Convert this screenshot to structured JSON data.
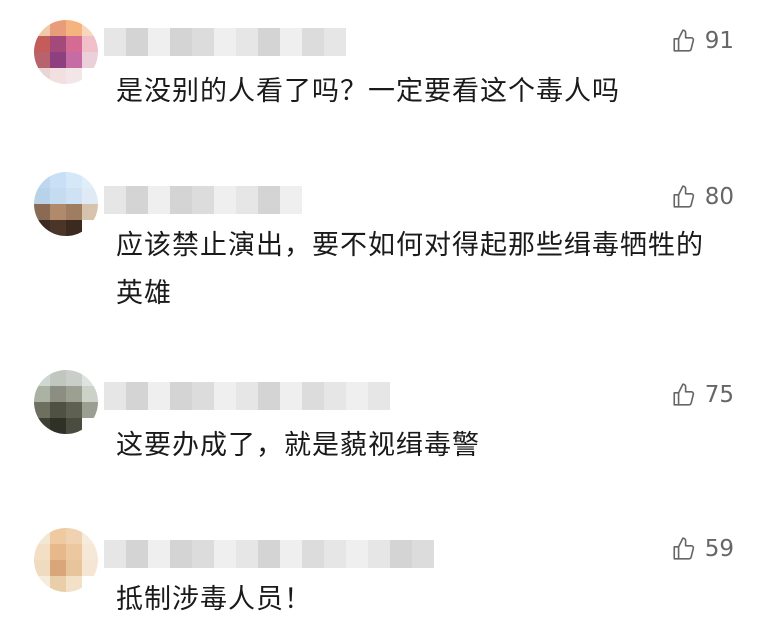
{
  "comments": [
    {
      "text": "是没别的人看了吗？一定要看这个毒人吗",
      "likes": "91",
      "like_icon": "thumbs-up-icon"
    },
    {
      "text": "应该禁止演出，要不如何对得起那些缉毒牺牲的英雄",
      "likes": "80",
      "like_icon": "thumbs-up-icon"
    },
    {
      "text": "这要办成了，就是藐视缉毒警",
      "likes": "75",
      "like_icon": "thumbs-up-icon"
    },
    {
      "text": "抵制涉毒人员！",
      "likes": "59",
      "like_icon": "thumbs-up-icon"
    }
  ],
  "colors": {
    "text": "#1a1a1a",
    "like_count": "#666666",
    "background": "#ffffff"
  }
}
